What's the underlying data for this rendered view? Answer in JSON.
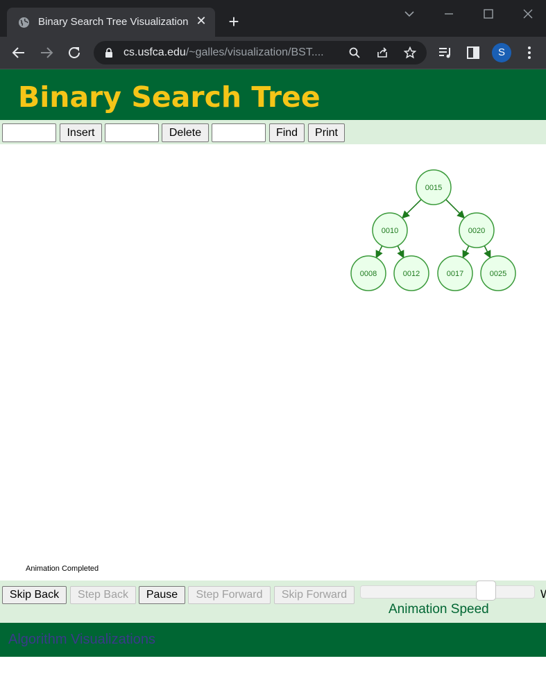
{
  "browser": {
    "tab_title": "Binary Search Tree Visualization",
    "url_host": "cs.usfca.edu",
    "url_path": "/~galles/visualization/BST....",
    "avatar_letter": "S"
  },
  "page": {
    "title": "Binary Search Tree",
    "controls": {
      "insert_label": "Insert",
      "delete_label": "Delete",
      "find_label": "Find",
      "print_label": "Print",
      "insert_value": "",
      "delete_value": "",
      "find_value": ""
    },
    "tree": {
      "nodes": [
        {
          "id": "n15",
          "label": "0015"
        },
        {
          "id": "n10",
          "label": "0010"
        },
        {
          "id": "n20",
          "label": "0020"
        },
        {
          "id": "n08",
          "label": "0008"
        },
        {
          "id": "n12",
          "label": "0012"
        },
        {
          "id": "n17",
          "label": "0017"
        },
        {
          "id": "n25",
          "label": "0025"
        }
      ],
      "edges": [
        [
          "n15",
          "n10"
        ],
        [
          "n15",
          "n20"
        ],
        [
          "n10",
          "n08"
        ],
        [
          "n10",
          "n12"
        ],
        [
          "n20",
          "n17"
        ],
        [
          "n20",
          "n25"
        ]
      ]
    },
    "status": "Animation Completed",
    "animation": {
      "skip_back": "Skip Back",
      "step_back": "Step Back",
      "pause": "Pause",
      "step_forward": "Step Forward",
      "skip_forward": "Skip Forward",
      "speed_label": "Animation Speed",
      "speed_fraction": 0.75,
      "cut_text": "W"
    },
    "footer_link": "Algorithm Visualizations"
  },
  "colors": {
    "header_green": "#006633",
    "title_yellow": "#f5c518",
    "panel_green": "#dcefdc",
    "node_fill": "#eaffea",
    "node_stroke": "#3a9a3a",
    "edge": "#1e7a1e"
  }
}
